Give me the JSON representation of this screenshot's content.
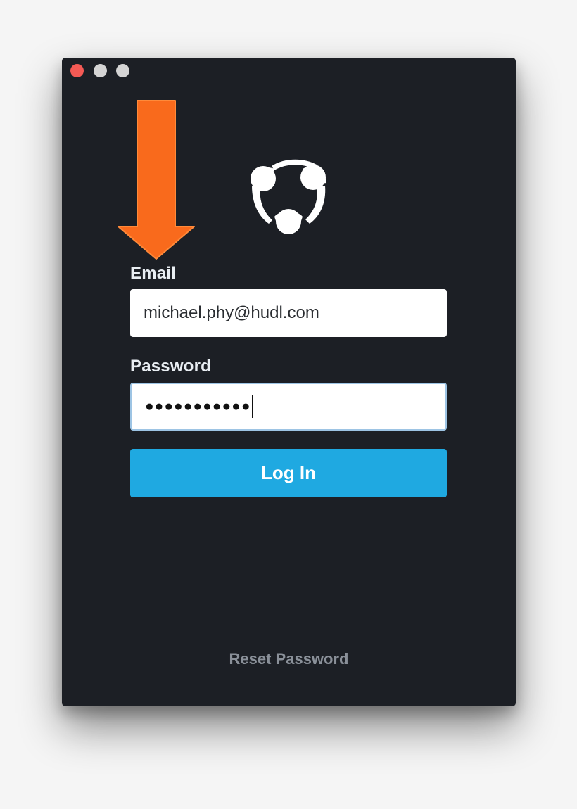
{
  "window": {
    "controls": [
      "close",
      "minimize",
      "maximize"
    ]
  },
  "annotation": {
    "icon": "arrow-down-icon",
    "color": "#f96a1c"
  },
  "logo": {
    "icon": "hudl-logo-icon",
    "color": "#ffffff"
  },
  "form": {
    "email_label": "Email",
    "email_value": "michael.phy@hudl.com",
    "password_label": "Password",
    "password_mask": "●●●●●●●●●●●",
    "login_label": "Log In",
    "accent_color": "#1fa9e1"
  },
  "footer": {
    "reset_label": "Reset Password"
  }
}
